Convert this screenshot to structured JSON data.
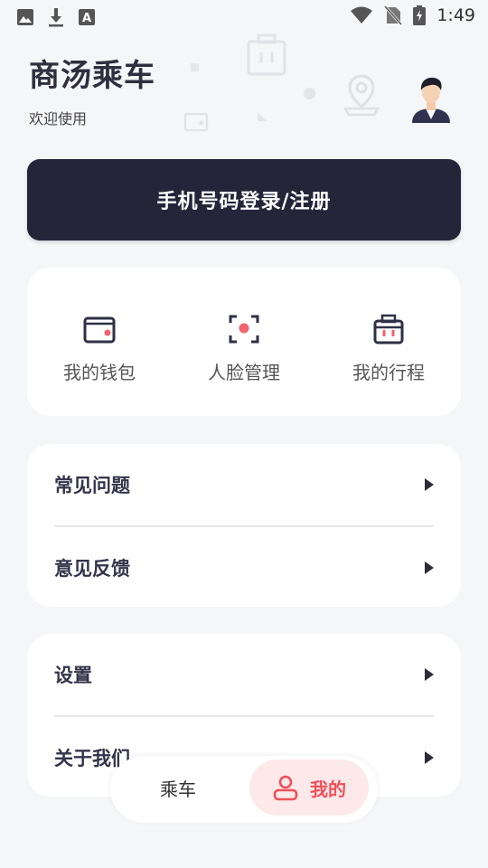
{
  "status_bar": {
    "time": "1:49",
    "left_icons": [
      "image-icon",
      "download-icon",
      "font-a-icon"
    ],
    "right_icons": [
      "wifi-icon",
      "no-sim-icon",
      "battery-charging-icon"
    ]
  },
  "header": {
    "app_title": "商汤乘车",
    "subtitle": "欢迎使用"
  },
  "login_button": "手机号码登录/注册",
  "quick_actions": [
    {
      "label": "我的钱包",
      "icon": "wallet-icon"
    },
    {
      "label": "人脸管理",
      "icon": "face-scan-icon"
    },
    {
      "label": "我的行程",
      "icon": "luggage-icon"
    }
  ],
  "menu_group_1": [
    {
      "label": "常见问题"
    },
    {
      "label": "意见反馈"
    }
  ],
  "menu_group_2": [
    {
      "label": "设置"
    },
    {
      "label": "关于我们"
    }
  ],
  "bottom_nav": {
    "ride_label": "乘车",
    "mine_label": "我的"
  },
  "colors": {
    "accent": "#f0505a",
    "dark_button": "#25253a",
    "background": "#f5f6f8"
  }
}
